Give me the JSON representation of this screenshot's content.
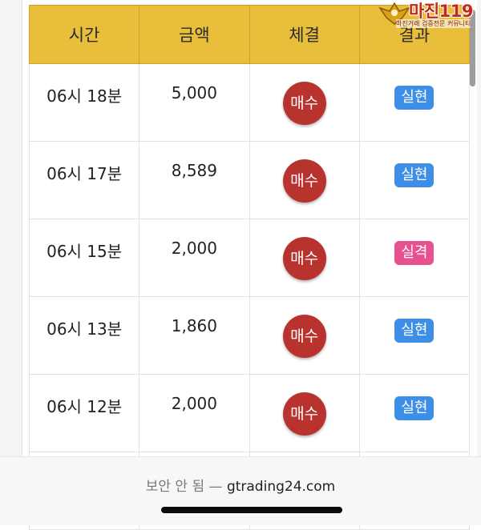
{
  "header": {
    "col_time": "시간",
    "col_amount": "금액",
    "col_fill": "체결",
    "col_result": "결과"
  },
  "rows": [
    {
      "time": "06시 18분",
      "amount": "5,000",
      "fill": "매수",
      "result": "실현",
      "result_color": "#3d8ee6"
    },
    {
      "time": "06시 17분",
      "amount": "8,589",
      "fill": "매수",
      "result": "실현",
      "result_color": "#3d8ee6"
    },
    {
      "time": "06시 15분",
      "amount": "2,000",
      "fill": "매수",
      "result": "실격",
      "result_color": "#e9508f"
    },
    {
      "time": "06시 13분",
      "amount": "1,860",
      "fill": "매수",
      "result": "실현",
      "result_color": "#3d8ee6"
    },
    {
      "time": "06시 12분",
      "amount": "2,000",
      "fill": "매수",
      "result": "실현",
      "result_color": "#3d8ee6"
    }
  ],
  "watermark": {
    "name": "마진119",
    "tagline": "마진거래 검증전문 커뮤니티"
  },
  "browser": {
    "security": "보안 안 됨",
    "separator": "—",
    "domain": "gtrading24.com"
  },
  "colors": {
    "header_bg": "#e9be3b",
    "buy_button": "#b8332e"
  }
}
